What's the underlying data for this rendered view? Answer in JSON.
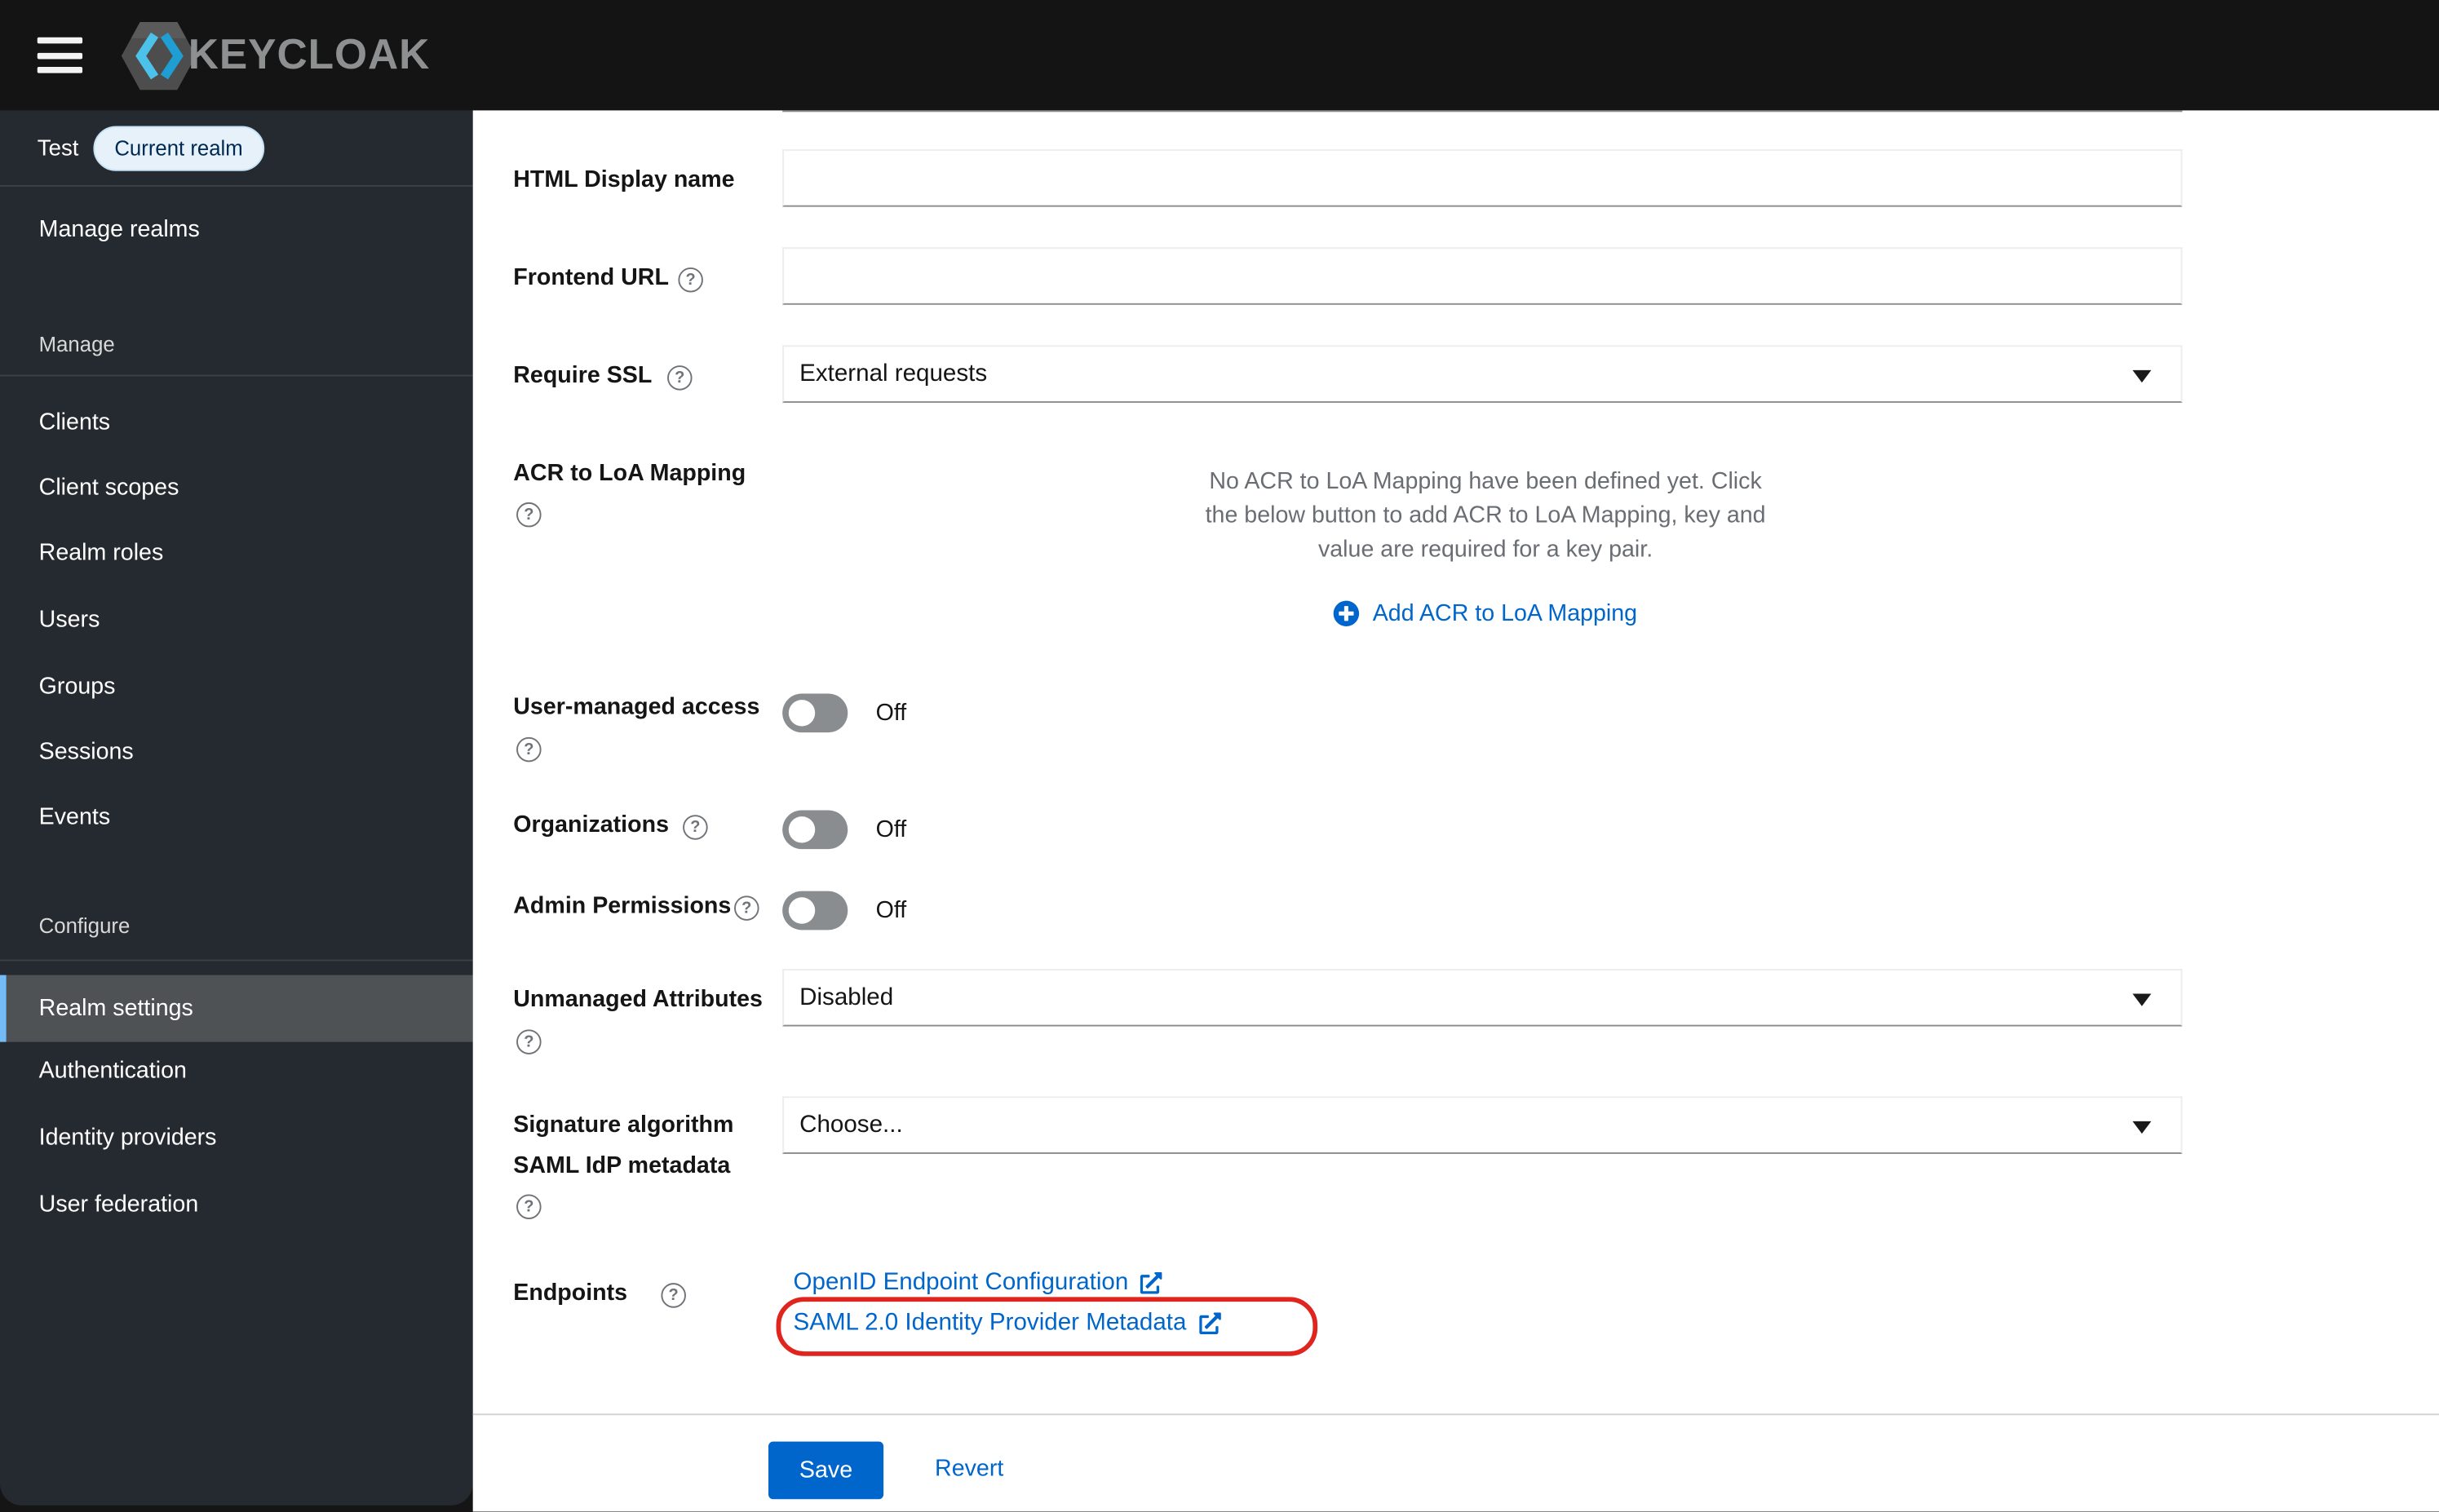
{
  "masthead": {
    "brand": "KEYCLOAK"
  },
  "sidebar": {
    "realm_name": "Test",
    "realm_badge": "Current realm",
    "manage_realms": "Manage realms",
    "sections": [
      {
        "title": "Manage",
        "items": [
          "Clients",
          "Client scopes",
          "Realm roles",
          "Users",
          "Groups",
          "Sessions",
          "Events"
        ]
      },
      {
        "title": "Configure",
        "items": [
          "Realm settings",
          "Authentication",
          "Identity providers",
          "User federation"
        ],
        "selected": "Realm settings"
      }
    ]
  },
  "form": {
    "html_display_name": {
      "label": "HTML Display name",
      "value": ""
    },
    "frontend_url": {
      "label": "Frontend URL",
      "value": ""
    },
    "require_ssl": {
      "label": "Require SSL",
      "value": "External requests"
    },
    "acr_mapping": {
      "label": "ACR to LoA Mapping",
      "empty_text": "No ACR to LoA Mapping have been defined yet. Click the below button to add ACR to LoA Mapping, key and value are required for a key pair.",
      "add_button": "Add ACR to LoA Mapping"
    },
    "user_managed_access": {
      "label": "User-managed access",
      "state": "Off"
    },
    "organizations": {
      "label": "Organizations",
      "state": "Off"
    },
    "admin_permissions": {
      "label": "Admin Permissions",
      "state": "Off"
    },
    "unmanaged_attributes": {
      "label": "Unmanaged Attributes",
      "value": "Disabled"
    },
    "signature_algorithm": {
      "label_line1": "Signature algorithm",
      "label_line2": "SAML IdP metadata",
      "value": "Choose..."
    },
    "endpoints": {
      "label": "Endpoints",
      "links": [
        "OpenID Endpoint Configuration",
        "SAML 2.0 Identity Provider Metadata"
      ]
    }
  },
  "footer": {
    "save": "Save",
    "revert": "Revert"
  },
  "icons": {
    "help": "?"
  },
  "colors": {
    "accent": "#0066cc",
    "masthead_bg": "#141414",
    "page_bg": "#151515",
    "sidebar_bg": "#242a30",
    "selected_item_bg": "#4f5255",
    "selected_item_border": "#73bcf7",
    "badge_bg": "#e7f1fa",
    "badge_text": "#002952",
    "annotation_red": "#e0241e",
    "toggle_off": "#8a8d90",
    "muted_text": "#6a6e73"
  }
}
